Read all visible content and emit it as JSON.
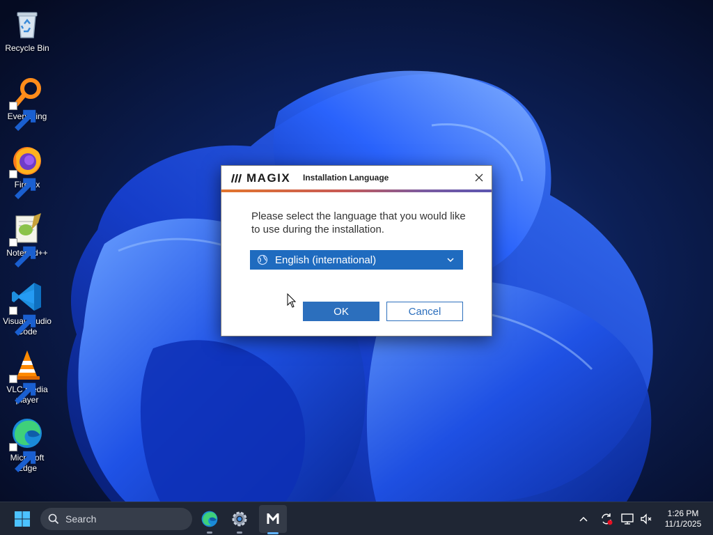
{
  "desktop": {
    "icons": [
      {
        "label": "Recycle Bin",
        "icon": "recycle-bin-icon"
      },
      {
        "label": "Everything",
        "icon": "everything-search-icon"
      },
      {
        "label": "Firefox",
        "icon": "firefox-icon"
      },
      {
        "label": "Notepad++",
        "icon": "notepadpp-icon"
      },
      {
        "label": "Visual Studio Code",
        "icon": "vscode-icon"
      },
      {
        "label": "VLC media player",
        "icon": "vlc-icon"
      },
      {
        "label": "Microsoft Edge",
        "icon": "edge-icon"
      }
    ]
  },
  "dialog": {
    "brand": "MAGIX",
    "title": "Installation Language",
    "message": "Please select the language that you would like to use during the installation.",
    "language_selected": "English (international)",
    "ok_label": "OK",
    "cancel_label": "Cancel",
    "accent_colors": [
      "#e2752d",
      "#7a5aa0"
    ],
    "primary_color": "#2c6fbd"
  },
  "taskbar": {
    "search_placeholder": "Search",
    "pinned": [
      "edge-icon",
      "settings-icon",
      "magix-icon"
    ],
    "active_app": "MAGIX",
    "clock_time": "1:26 PM",
    "clock_date": "11/1/2025"
  }
}
